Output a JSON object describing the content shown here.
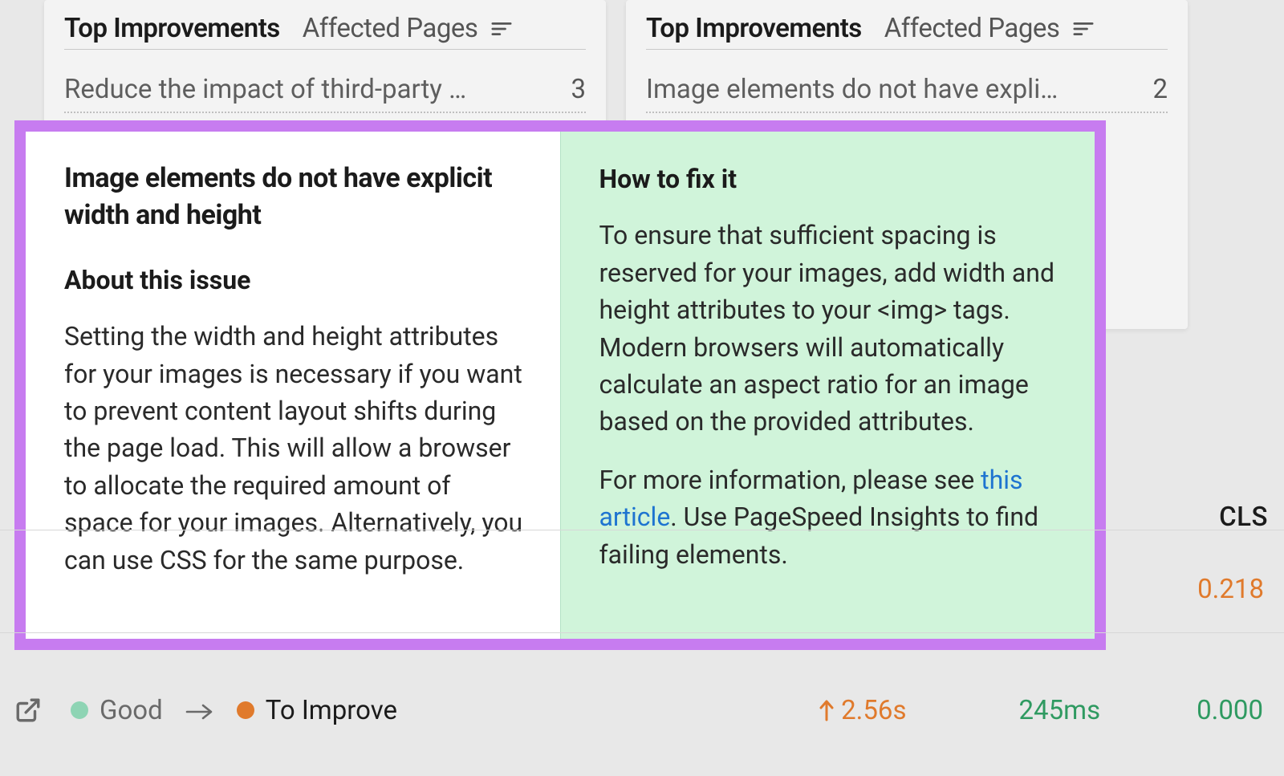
{
  "cards": {
    "left": {
      "tab_active": "Top Improvements",
      "tab_sort": "Affected Pages",
      "row_title": "Reduce the impact of third-party …",
      "row_count": "3"
    },
    "right": {
      "tab_active": "Top Improvements",
      "tab_sort": "Affected Pages",
      "row_title": "Image elements do not have expli…",
      "row_count": "2"
    }
  },
  "issue": {
    "title": "Image elements do not have explicit width and height",
    "about_heading": "About this issue",
    "about_body": "Setting the width and height attributes for your images is necessary if you want to prevent content layout shifts during the page load. This will allow a browser to allocate the required amount of space for your images. Alternatively, you can use CSS for the same purpose.",
    "fix_heading": "How to fix it",
    "fix_body1": "To ensure that sufficient spacing is reserved for your images, add width and height attributes to your <img> tags. Modern browsers will automatically calculate an aspect ratio for an image based on the provided attributes.",
    "fix_body2_prefix": "For more information, please see ",
    "fix_body2_link": "this article",
    "fix_body2_suffix": ". Use PageSpeed Insights to find failing elements."
  },
  "metrics": {
    "col_header": "CLS",
    "status_good": "Good",
    "status_improve": "To Improve",
    "val_time_up": "2.56s",
    "val_ms": "245ms",
    "val_cls_row1": "0.218",
    "val_cls_row2": "0.000"
  }
}
